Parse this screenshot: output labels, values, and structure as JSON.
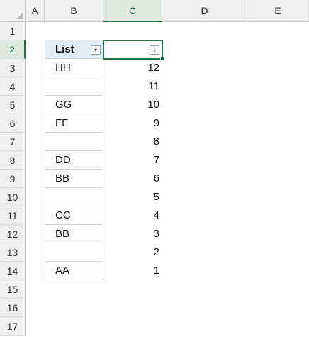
{
  "columns": [
    "A",
    "B",
    "C",
    "D",
    "E"
  ],
  "rows": [
    "1",
    "2",
    "3",
    "4",
    "5",
    "6",
    "7",
    "8",
    "9",
    "10",
    "11",
    "12",
    "13",
    "14",
    "15",
    "16",
    "17"
  ],
  "table": {
    "header": "List",
    "column_b": [
      "HH",
      "",
      "GG",
      "FF",
      "",
      "DD",
      "BB",
      "",
      "CC",
      "BB",
      "",
      "AA"
    ],
    "column_c": [
      "12",
      "11",
      "10",
      "9",
      "8",
      "7",
      "6",
      "5",
      "4",
      "3",
      "2",
      "1"
    ]
  },
  "colors": {
    "selection": "#217346",
    "header_fill": "#ddebf7"
  }
}
